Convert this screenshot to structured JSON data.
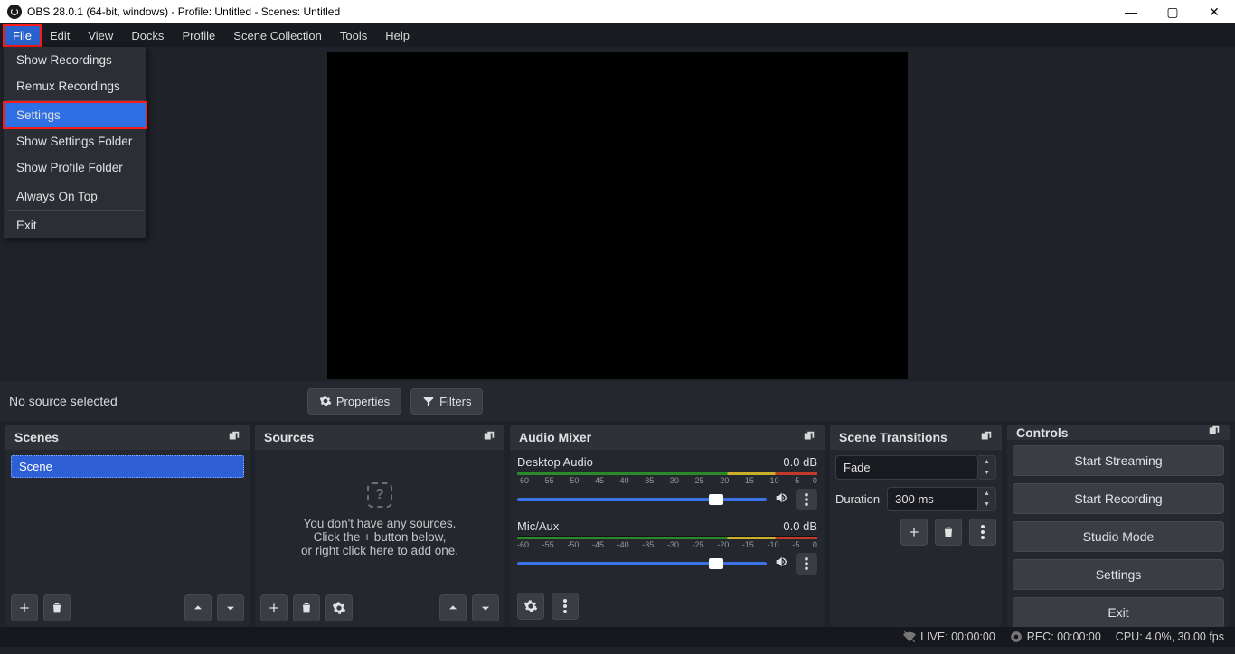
{
  "titlebar": {
    "text": "OBS 28.0.1 (64-bit, windows) - Profile: Untitled - Scenes: Untitled"
  },
  "menubar": [
    "File",
    "Edit",
    "View",
    "Docks",
    "Profile",
    "Scene Collection",
    "Tools",
    "Help"
  ],
  "dropdown": {
    "show_recordings": "Show Recordings",
    "remux_recordings": "Remux Recordings",
    "settings": "Settings",
    "show_settings_folder": "Show Settings Folder",
    "show_profile_folder": "Show Profile Folder",
    "always_on_top": "Always On Top",
    "exit": "Exit"
  },
  "toolbar": {
    "no_source": "No source selected",
    "properties": "Properties",
    "filters": "Filters"
  },
  "panels": {
    "scenes": {
      "title": "Scenes",
      "item": "Scene"
    },
    "sources": {
      "title": "Sources",
      "empty1": "You don't have any sources.",
      "empty2": "Click the + button below,",
      "empty3": "or right click here to add one."
    },
    "mixer": {
      "title": "Audio Mixer",
      "ch1": {
        "name": "Desktop Audio",
        "db": "0.0 dB"
      },
      "ch2": {
        "name": "Mic/Aux",
        "db": "0.0 dB"
      },
      "ticks": [
        "-60",
        "-55",
        "-50",
        "-45",
        "-40",
        "-35",
        "-30",
        "-25",
        "-20",
        "-15",
        "-10",
        "-5",
        "0"
      ]
    },
    "transitions": {
      "title": "Scene Transitions",
      "selected": "Fade",
      "duration_label": "Duration",
      "duration_value": "300 ms"
    },
    "controls": {
      "title": "Controls",
      "start_streaming": "Start Streaming",
      "start_recording": "Start Recording",
      "studio_mode": "Studio Mode",
      "settings": "Settings",
      "exit": "Exit"
    }
  },
  "statusbar": {
    "live": "LIVE: 00:00:00",
    "rec": "REC: 00:00:00",
    "cpu": "CPU: 4.0%, 30.00 fps"
  }
}
